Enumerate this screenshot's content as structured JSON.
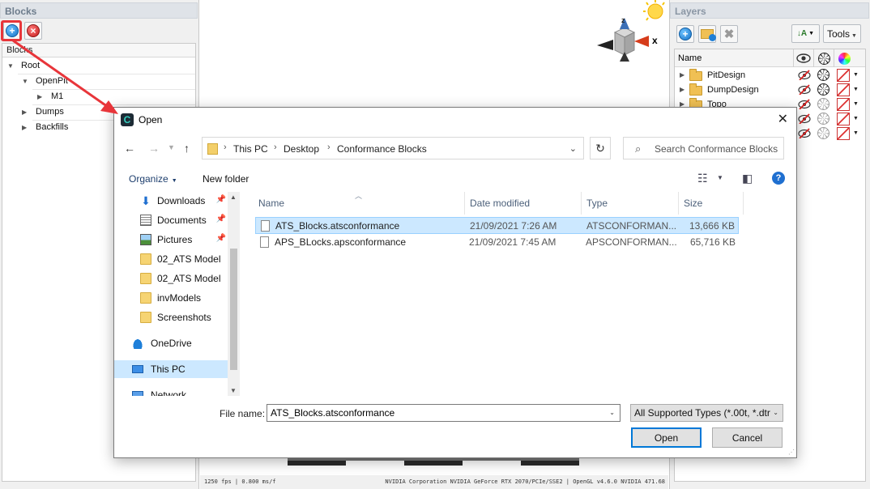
{
  "blocks_panel": {
    "title": "Blocks",
    "tree_header": "Blocks",
    "tree": [
      {
        "label": "Root",
        "level": 0,
        "expanded": true
      },
      {
        "label": "OpenPit",
        "level": 1,
        "expanded": true
      },
      {
        "label": "M1",
        "level": 2,
        "expanded": false
      },
      {
        "label": "Dumps",
        "level": 1,
        "expanded": false
      },
      {
        "label": "Backfills",
        "level": 1,
        "expanded": false
      }
    ]
  },
  "viewport": {
    "axis_label": "x",
    "fps_text": "1250 fps | 0.800 ms/f",
    "gpu_text": "NVIDIA Corporation NVIDIA GeForce RTX 2070/PCIe/SSE2 | OpenGL v4.6.0 NVIDIA 471.68"
  },
  "layers_panel": {
    "title": "Layers",
    "tools_label": "Tools",
    "name_header": "Name",
    "layers": [
      {
        "name": "PitDesign",
        "wheel_faded": false
      },
      {
        "name": "DumpDesign",
        "wheel_faded": false
      },
      {
        "name": "Topo",
        "wheel_faded": true
      },
      {
        "name": "",
        "wheel_faded": true
      },
      {
        "name": "",
        "wheel_faded": true
      }
    ]
  },
  "dialog": {
    "title": "Open",
    "breadcrumbs": [
      "This PC",
      "Desktop",
      "Conformance Blocks"
    ],
    "search_placeholder": "Search Conformance Blocks",
    "organize_label": "Organize",
    "new_folder_label": "New folder",
    "nav_items": [
      {
        "label": "Downloads",
        "icon": "download-icon",
        "pinned": true
      },
      {
        "label": "Documents",
        "icon": "documents-icon",
        "pinned": true
      },
      {
        "label": "Pictures",
        "icon": "pictures-icon",
        "pinned": true
      },
      {
        "label": "02_ATS Model",
        "icon": "folder-icon",
        "pinned": false
      },
      {
        "label": "02_ATS Model",
        "icon": "folder-icon",
        "pinned": false
      },
      {
        "label": "invModels",
        "icon": "folder-icon",
        "pinned": false
      },
      {
        "label": "Screenshots",
        "icon": "folder-icon",
        "pinned": false
      },
      {
        "label": "OneDrive",
        "icon": "onedrive-icon",
        "pinned": false
      },
      {
        "label": "This PC",
        "icon": "this-pc-icon",
        "pinned": false,
        "selected": true
      },
      {
        "label": "Network",
        "icon": "network-icon",
        "pinned": false
      }
    ],
    "columns": {
      "name": "Name",
      "date": "Date modified",
      "type": "Type",
      "size": "Size"
    },
    "files": [
      {
        "name": "ATS_Blocks.atsconformance",
        "date": "21/09/2021 7:26 AM",
        "type": "ATSCONFORMAN...",
        "size": "13,666 KB",
        "selected": true
      },
      {
        "name": "APS_BLocks.apsconformance",
        "date": "21/09/2021 7:45 AM",
        "type": "APSCONFORMAN...",
        "size": "65,716 KB",
        "selected": false
      }
    ],
    "file_name_label": "File name:",
    "file_name_value": "ATS_Blocks.atsconformance",
    "file_type_value": "All Supported Types (*.00t, *.dtr",
    "open_label": "Open",
    "cancel_label": "Cancel"
  },
  "colors": {
    "highlight": "#e8353a",
    "selection": "#cce8ff",
    "accent": "#0078d7"
  }
}
